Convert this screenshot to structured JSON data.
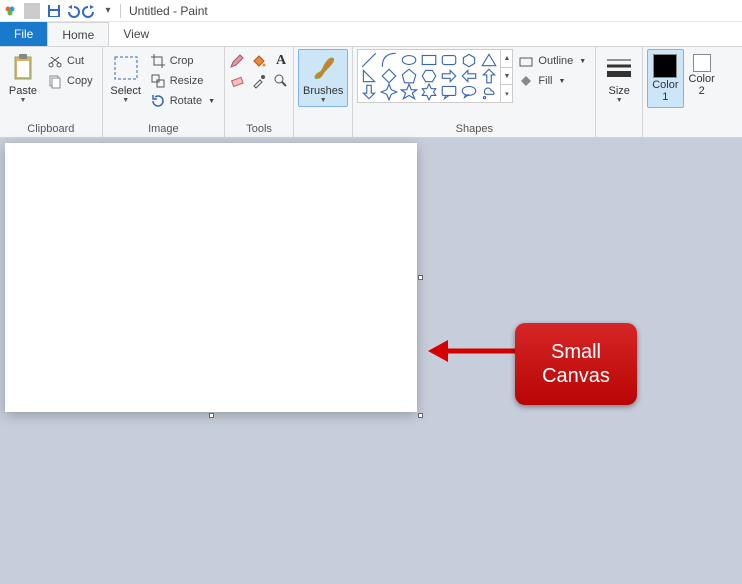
{
  "title": "Untitled - Paint",
  "tabs": {
    "file": "File",
    "home": "Home",
    "view": "View"
  },
  "groups": {
    "clipboard": {
      "label": "Clipboard",
      "paste": "Paste",
      "cut": "Cut",
      "copy": "Copy"
    },
    "image": {
      "label": "Image",
      "select": "Select",
      "crop": "Crop",
      "resize": "Resize",
      "rotate": "Rotate"
    },
    "tools": {
      "label": "Tools"
    },
    "brushes": {
      "label": "Brushes"
    },
    "shapes": {
      "label": "Shapes",
      "outline": "Outline",
      "fill": "Fill"
    },
    "size": {
      "label": "Size"
    },
    "colors": {
      "c1": "Color\n1",
      "c2": "Color\n2"
    }
  },
  "callout": "Small\nCanvas"
}
